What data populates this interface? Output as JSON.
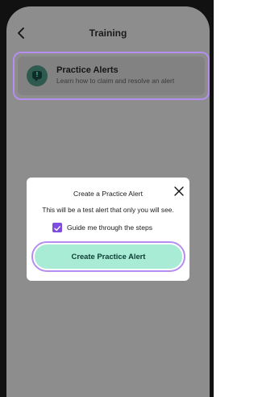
{
  "header": {
    "title": "Training",
    "back_icon": "chevron-left-icon"
  },
  "card": {
    "title": "Practice Alerts",
    "subtitle": "Learn how to claim and resolve an alert",
    "icon": "alert-chat-icon",
    "icon_glyph": "!"
  },
  "modal": {
    "title": "Create a Practice Alert",
    "close_icon": "close-icon",
    "description": "This will be a test alert that only you will see.",
    "checkbox_label": "Guide me through the steps",
    "checkbox_checked": true,
    "button_label": "Create Practice Alert"
  },
  "colors": {
    "accent": "#7c4dde",
    "highlight": "#b48ef0",
    "button_bg": "#a8ecd6",
    "overlay": "#8d8d8d"
  }
}
